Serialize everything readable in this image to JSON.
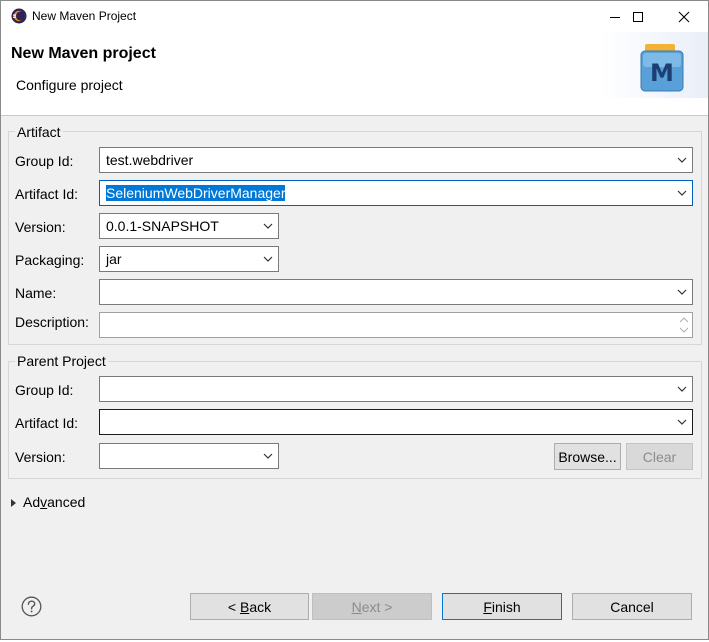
{
  "window": {
    "title": "New Maven Project"
  },
  "header": {
    "title": "New Maven project",
    "subtitle": "Configure project",
    "logo_letter": "M"
  },
  "artifact": {
    "group_label": "Artifact",
    "group_id": {
      "label": "Group Id:",
      "value": "test.webdriver"
    },
    "artifact_id": {
      "label": "Artifact Id:",
      "value": "SeleniumWebDriverManager"
    },
    "version": {
      "label": "Version:",
      "value": "0.0.1-SNAPSHOT"
    },
    "packaging": {
      "label": "Packaging:",
      "value": "jar"
    },
    "name": {
      "label": "Name:",
      "value": ""
    },
    "description": {
      "label": "Description:",
      "value": ""
    }
  },
  "parent": {
    "group_label": "Parent Project",
    "group_id": {
      "label": "Group Id:",
      "value": ""
    },
    "artifact_id": {
      "label": "Artifact Id:",
      "value": ""
    },
    "version": {
      "label": "Version:",
      "value": ""
    },
    "browse_label": "Browse...",
    "clear_label": "Clear"
  },
  "advanced": {
    "prefix": "Ad",
    "accel": "v",
    "suffix": "anced"
  },
  "buttons": {
    "back": {
      "prefix": "< ",
      "accel": "B",
      "suffix": "ack"
    },
    "next": {
      "prefix": "",
      "accel": "N",
      "suffix": "ext >"
    },
    "finish": {
      "prefix": "",
      "accel": "F",
      "suffix": "inish"
    },
    "cancel": "Cancel"
  },
  "colors": {
    "selection": "#0078d7",
    "default_button_border": "#0078d7",
    "dialog_bg": "#f0f0f0"
  }
}
